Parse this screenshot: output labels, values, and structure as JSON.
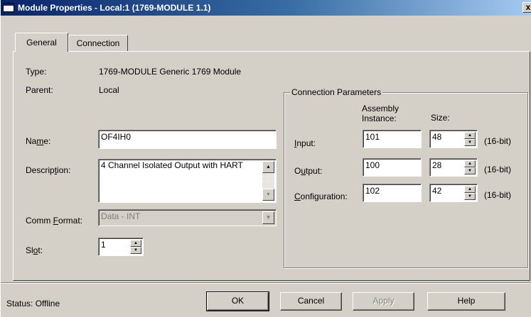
{
  "window": {
    "title": "Module Properties  - Local:1 (1769-MODULE 1.1)",
    "close_glyph": "x"
  },
  "tabs": [
    {
      "label": "General",
      "active": true
    },
    {
      "label": "Connection",
      "active": false
    }
  ],
  "general": {
    "type_label": "Type:",
    "type_value": "1769-MODULE Generic 1769 Module",
    "parent_label": "Parent:",
    "parent_value": "Local",
    "name_label_pre": "Na",
    "name_label_key": "m",
    "name_label_post": "e:",
    "name_value": "OF4IH0",
    "description_label_pre": "Descrip",
    "description_label_key": "t",
    "description_label_post": "ion:",
    "description_value": "4 Channel Isolated Output with HART",
    "comm_format_label_pre": "Comm ",
    "comm_format_label_key": "F",
    "comm_format_label_post": "ormat:",
    "comm_format_value": "Data - INT",
    "slot_label_pre": "Sl",
    "slot_label_key": "o",
    "slot_label_post": "t:",
    "slot_value": "1"
  },
  "connection_parameters": {
    "title": "Connection Parameters",
    "assembly_header_line1": "Assembly",
    "assembly_header_line2": "Instance:",
    "size_header": "Size:",
    "rows": [
      {
        "label_key": "I",
        "label_post": "nput:",
        "label_pre": "",
        "instance": "101",
        "size": "48",
        "unit": "(16-bit)"
      },
      {
        "label_key": "u",
        "label_post": "tput:",
        "label_pre": "O",
        "instance": "100",
        "size": "28",
        "unit": "(16-bit)"
      },
      {
        "label_key": "C",
        "label_post": "onfiguration:",
        "label_pre": "",
        "instance": "102",
        "size": "42",
        "unit": "(16-bit)"
      }
    ]
  },
  "footer": {
    "status": "Status:  Offline",
    "ok": "OK",
    "cancel": "Cancel",
    "apply": "Apply",
    "help": "Help"
  },
  "icons": {
    "spin_up": "▲",
    "spin_down": "▼",
    "combo_arrow": "▼"
  },
  "colors": {
    "titlebar_start": "#0a246a",
    "titlebar_end": "#a6caf0",
    "dialog_face": "#d4d0c8",
    "disabled_text": "#808080"
  }
}
